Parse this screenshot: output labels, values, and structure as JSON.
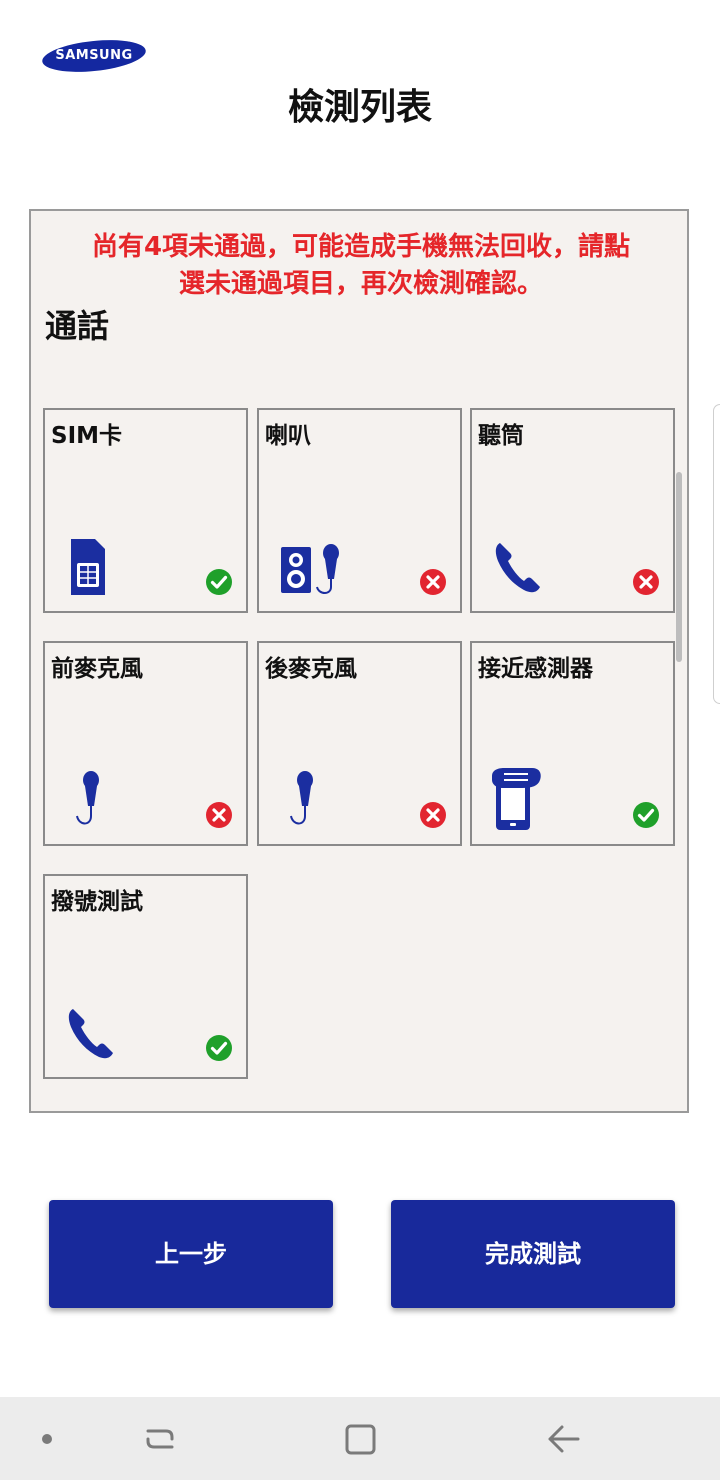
{
  "brand": {
    "logo_text": "SAMSUNG",
    "logo_color": "#1428a0"
  },
  "header": {
    "title": "檢測列表"
  },
  "panel": {
    "warning_line1": "尚有4項未通過，可能造成手機無法回收，請點",
    "warning_line2": "選未通過項目，再次檢測確認。",
    "warning_color": "#e5262a",
    "section_title": "通話",
    "items": [
      {
        "label": "SIM卡",
        "icon": "sim-card-icon",
        "status": "pass"
      },
      {
        "label": "喇叭",
        "icon": "speaker-microphone-icon",
        "status": "fail"
      },
      {
        "label": "聽筒",
        "icon": "phone-handset-icon",
        "status": "fail"
      },
      {
        "label": "前麥克風",
        "icon": "microphone-icon",
        "status": "fail"
      },
      {
        "label": "後麥克風",
        "icon": "microphone-icon",
        "status": "fail"
      },
      {
        "label": "接近感測器",
        "icon": "proximity-sensor-icon",
        "status": "pass"
      },
      {
        "label": "撥號測試",
        "icon": "phone-handset-icon",
        "status": "pass"
      }
    ]
  },
  "buttons": {
    "prev_label": "上一步",
    "done_label": "完成測試",
    "color": "#18299b"
  },
  "status_colors": {
    "pass": "#1fa02a",
    "fail": "#e22530"
  },
  "icon_color": "#1b2ea0",
  "navbar": {
    "items": [
      "dot-icon",
      "recent-apps-icon",
      "home-icon",
      "back-icon"
    ]
  }
}
